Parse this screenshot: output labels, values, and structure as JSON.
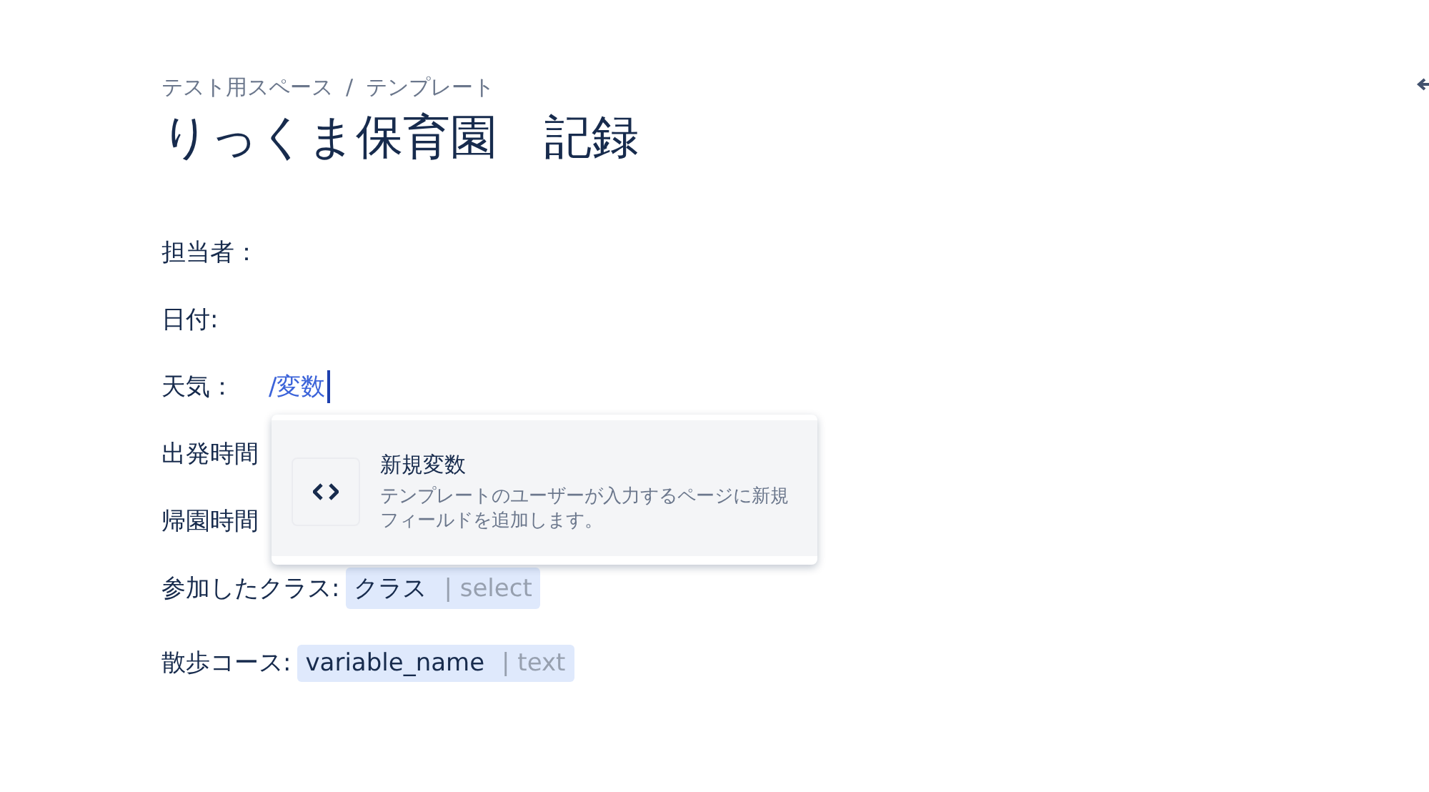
{
  "breadcrumb": {
    "items": [
      "テスト用スペース",
      "テンプレート"
    ],
    "separator": "/"
  },
  "title": "りっくま保育園　記録",
  "fields": [
    {
      "label": "担当者："
    },
    {
      "label": "日付:"
    },
    {
      "label": "天気：",
      "typed": "/変数",
      "cursor": true
    },
    {
      "label": "出発時間"
    },
    {
      "label": "帰園時間"
    },
    {
      "label": "参加したクラス:",
      "variable": {
        "name": "クラス",
        "type": "| select"
      }
    },
    {
      "label": "散歩コース:",
      "variable": {
        "name": "variable_name",
        "type": "| text"
      }
    }
  ],
  "slash_menu": {
    "items": [
      {
        "title": "新規変数",
        "description": "テンプレートのユーザーが入力するページに新規フィールドを追加します。"
      }
    ]
  }
}
